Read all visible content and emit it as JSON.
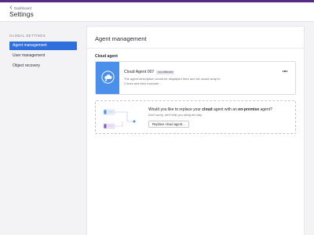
{
  "header": {
    "breadcrumb": "Dashboard",
    "title": "Settings",
    "accent_color": "#5b2a86"
  },
  "sidebar": {
    "heading": "GLOBAL SETTINGS",
    "items": [
      {
        "label": "Agent management",
        "active": true
      },
      {
        "label": "User management",
        "active": false
      },
      {
        "label": "Object recovery",
        "active": false
      }
    ],
    "active_color": "#2f6fdc"
  },
  "main": {
    "title": "Agent management",
    "section_label": "Cloud agent",
    "agent": {
      "name": "Cloud Agent 007",
      "badge": "non-bitlocker",
      "description": "The agent description would be displayed here and we would wrap to 2 lines and then truncate...",
      "icon": "cloud-icon",
      "icon_bg": "#4a8fea",
      "more_icon": "more-horizontal-icon"
    },
    "replace": {
      "question_prefix": "Would you like to replace your",
      "question_bold_1": "cloud",
      "question_mid": "agent with an",
      "question_bold_2": "on-premise",
      "question_suffix": "agent?",
      "note": "Don't worry, we'll help you along the way.",
      "button_label": "Replace cloud agent..."
    }
  }
}
